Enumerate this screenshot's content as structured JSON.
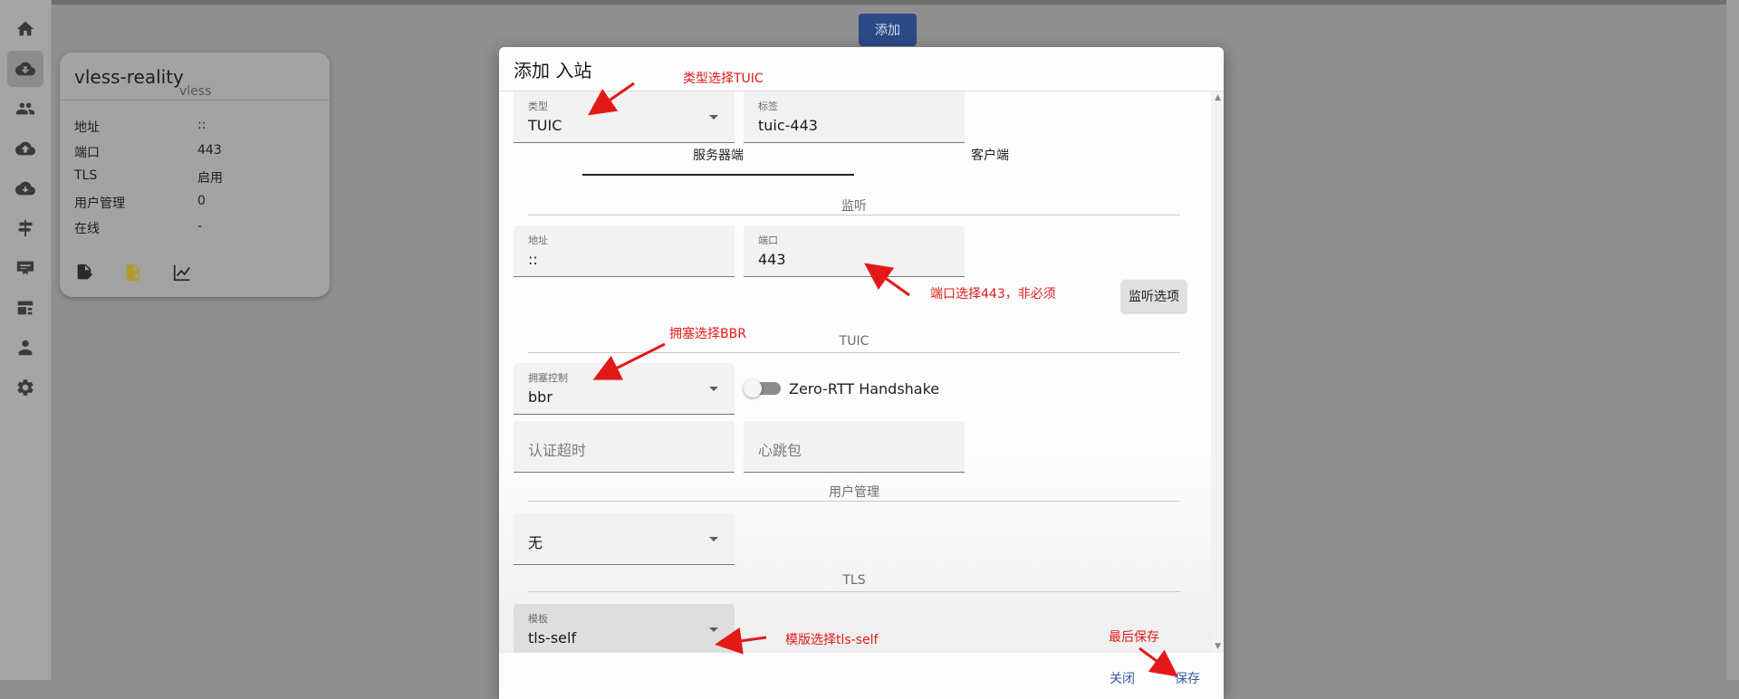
{
  "sidebar": {
    "icons": [
      "home-icon",
      "inbound-icon",
      "users-icon",
      "cloud-upload-icon",
      "cloud-sync-icon",
      "route-icon",
      "certificate-icon",
      "server-settings-icon",
      "admin-icon",
      "settings-icon"
    ],
    "active_index": 1
  },
  "page": {
    "add_button": "添加"
  },
  "card": {
    "title": "vless-reality",
    "protocol": "vless",
    "rows": [
      {
        "label": "地址",
        "value": "::"
      },
      {
        "label": "端口",
        "value": "443"
      },
      {
        "label": "TLS",
        "value": "启用"
      },
      {
        "label": "用户管理",
        "value": "0"
      },
      {
        "label": "在线",
        "value": "-"
      }
    ],
    "actions": [
      "edit-icon",
      "delete-file-icon",
      "chart-icon"
    ]
  },
  "modal": {
    "title": "添加 入站",
    "type_field": {
      "label": "类型",
      "value": "TUIC"
    },
    "tag_field": {
      "label": "标签",
      "value": "tuic-443"
    },
    "tabs": [
      "服务器端",
      "客户端"
    ],
    "active_tab": "服务器端",
    "listen_section": "监听",
    "address_field": {
      "label": "地址",
      "value": "::"
    },
    "port_field": {
      "label": "端口",
      "value": "443"
    },
    "listen_options_button": "监听选项",
    "tuic_section": "TUIC",
    "congestion_field": {
      "label": "拥塞控制",
      "value": "bbr"
    },
    "zero_rtt": {
      "label": "Zero-RTT Handshake",
      "checked": false
    },
    "auth_timeout_placeholder": "认证超时",
    "heartbeat_placeholder": "心跳包",
    "users_section": "用户管理",
    "users_select_value": "无",
    "tls_section": "TLS",
    "template_field": {
      "label": "模板",
      "value": "tls-self"
    },
    "close_button": "关闭",
    "save_button": "保存"
  },
  "annotations": {
    "type": "类型选择TUIC",
    "port": "端口选择443，非必须",
    "congestion": "拥塞选择BBR",
    "template": "模版选择tls-self",
    "save": "最后保存",
    "color": "#e31919"
  }
}
